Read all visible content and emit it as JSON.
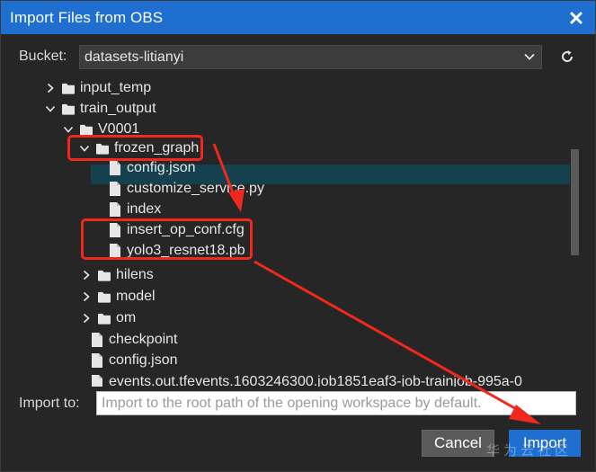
{
  "dialog": {
    "title": "Import Files from OBS",
    "close_icon": "close-icon"
  },
  "bucket": {
    "label": "Bucket:",
    "selected": "datasets-litianyi",
    "refresh_icon": "refresh-icon"
  },
  "tree": {
    "items": [
      {
        "label": "input_temp",
        "type": "folder",
        "expanded": false
      },
      {
        "label": "train_output",
        "type": "folder",
        "expanded": true
      },
      {
        "label": "V0001",
        "type": "folder",
        "expanded": true
      },
      {
        "label": "frozen_graph",
        "type": "folder",
        "expanded": true
      },
      {
        "label": "config.json",
        "type": "file"
      },
      {
        "label": "customize_service.py",
        "type": "file"
      },
      {
        "label": "index",
        "type": "file"
      },
      {
        "label": "insert_op_conf.cfg",
        "type": "file"
      },
      {
        "label": "yolo3_resnet18.pb",
        "type": "file",
        "selected": true
      },
      {
        "label": "hilens",
        "type": "folder",
        "expanded": false
      },
      {
        "label": "model",
        "type": "folder",
        "expanded": false
      },
      {
        "label": "om",
        "type": "folder",
        "expanded": false
      },
      {
        "label": "checkpoint",
        "type": "file"
      },
      {
        "label": "config.json",
        "type": "file"
      },
      {
        "label": "events.out.tfevents.1603246300.job1851eaf3-job-trainjob-995a-0",
        "type": "file"
      }
    ]
  },
  "import_to": {
    "label": "Import to:",
    "value": "",
    "placeholder": "Import to the root path of the opening workspace by default."
  },
  "buttons": {
    "cancel": "Cancel",
    "import": "Import"
  },
  "watermark": "华为云社区",
  "colors": {
    "title_bar": "#1f6fd1",
    "panel_bg": "#262626",
    "selected_row": "#14414d",
    "annotation_red": "#f0281e"
  }
}
